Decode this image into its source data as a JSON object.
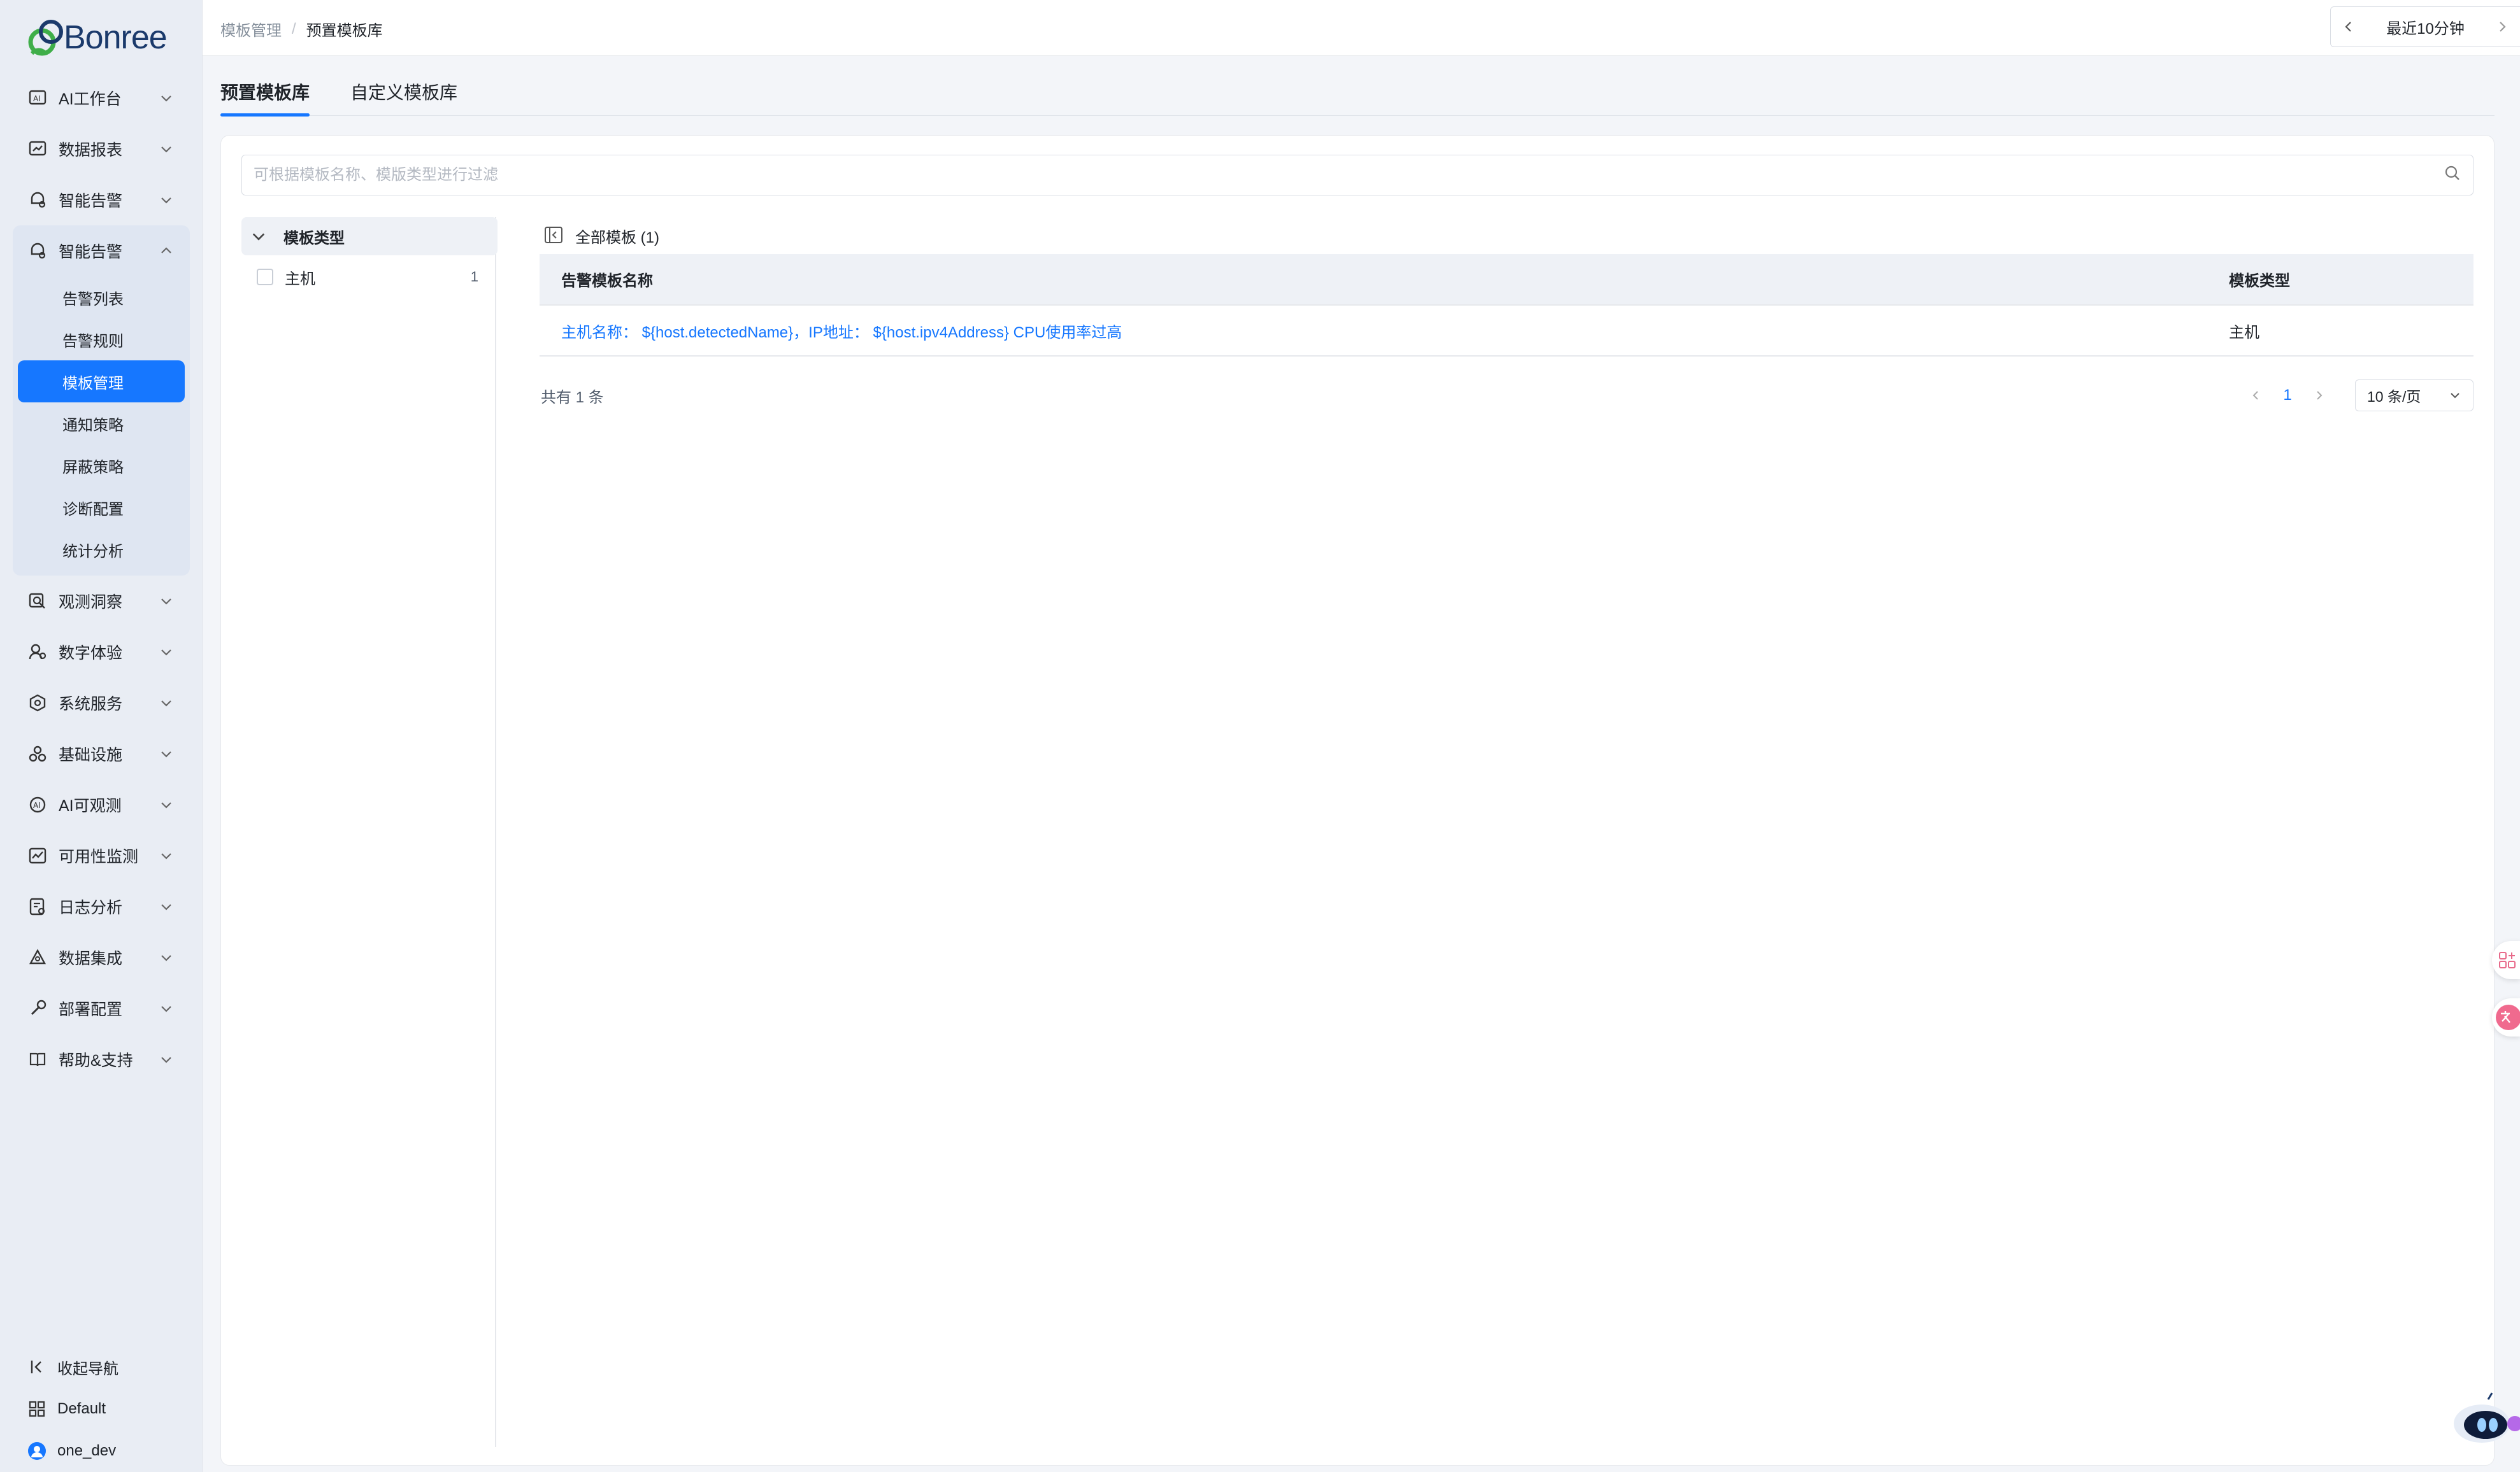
{
  "app": {
    "logo_text": "Bonree"
  },
  "sidebar": {
    "items_top": [
      {
        "label": "AI工作台",
        "icon": "ai-workbench-icon"
      },
      {
        "label": "数据报表",
        "icon": "report-icon"
      },
      {
        "label": "智能告警",
        "icon": "alert-icon"
      }
    ],
    "group": {
      "label": "智能告警",
      "icon": "alert-icon",
      "children": [
        {
          "label": "告警列表",
          "active": false
        },
        {
          "label": "告警规则",
          "active": false
        },
        {
          "label": "模板管理",
          "active": true
        },
        {
          "label": "通知策略",
          "active": false
        },
        {
          "label": "屏蔽策略",
          "active": false
        },
        {
          "label": "诊断配置",
          "active": false
        },
        {
          "label": "统计分析",
          "active": false
        }
      ]
    },
    "items_bottom": [
      {
        "label": "观测洞察",
        "icon": "observe-icon"
      },
      {
        "label": "数字体验",
        "icon": "digital-experience-icon"
      },
      {
        "label": "系统服务",
        "icon": "system-service-icon"
      },
      {
        "label": "基础设施",
        "icon": "infrastructure-icon"
      },
      {
        "label": "AI可观测",
        "icon": "ai-observe-icon"
      },
      {
        "label": "可用性监测",
        "icon": "availability-icon"
      },
      {
        "label": "日志分析",
        "icon": "log-icon"
      },
      {
        "label": "数据集成",
        "icon": "data-integration-icon"
      },
      {
        "label": "部署配置",
        "icon": "deploy-icon"
      },
      {
        "label": "帮助&支持",
        "icon": "help-icon"
      }
    ],
    "collapse_label": "收起导航",
    "workspace_label": "Default",
    "user_label": "one_dev"
  },
  "topbar": {
    "breadcrumb_parent": "模板管理",
    "breadcrumb_sep": "/",
    "breadcrumb_current": "预置模板库",
    "time_range": "最近10分钟"
  },
  "tabs": [
    {
      "label": "预置模板库",
      "active": true
    },
    {
      "label": "自定义模板库",
      "active": false
    }
  ],
  "search": {
    "placeholder": "可根据模板名称、模版类型进行过滤"
  },
  "tree": {
    "header": "模板类型",
    "items": [
      {
        "label": "主机",
        "count": "1"
      }
    ]
  },
  "content": {
    "title": "全部模板 (1)",
    "table": {
      "headers": [
        "告警模板名称",
        "模板类型"
      ],
      "rows": [
        {
          "name": "主机名称： ${host.detectedName}，IP地址： ${host.ipv4Address} CPU使用率过高",
          "type": "主机"
        }
      ]
    },
    "pagination": {
      "total": "共有 1 条",
      "current_page": "1",
      "page_size": "10 条/页"
    }
  },
  "colors": {
    "accent": "#1677ff",
    "sidebar_bg": "#e9edf4",
    "logo_green": "#3fae49",
    "logo_blue": "#1b3a6b"
  }
}
